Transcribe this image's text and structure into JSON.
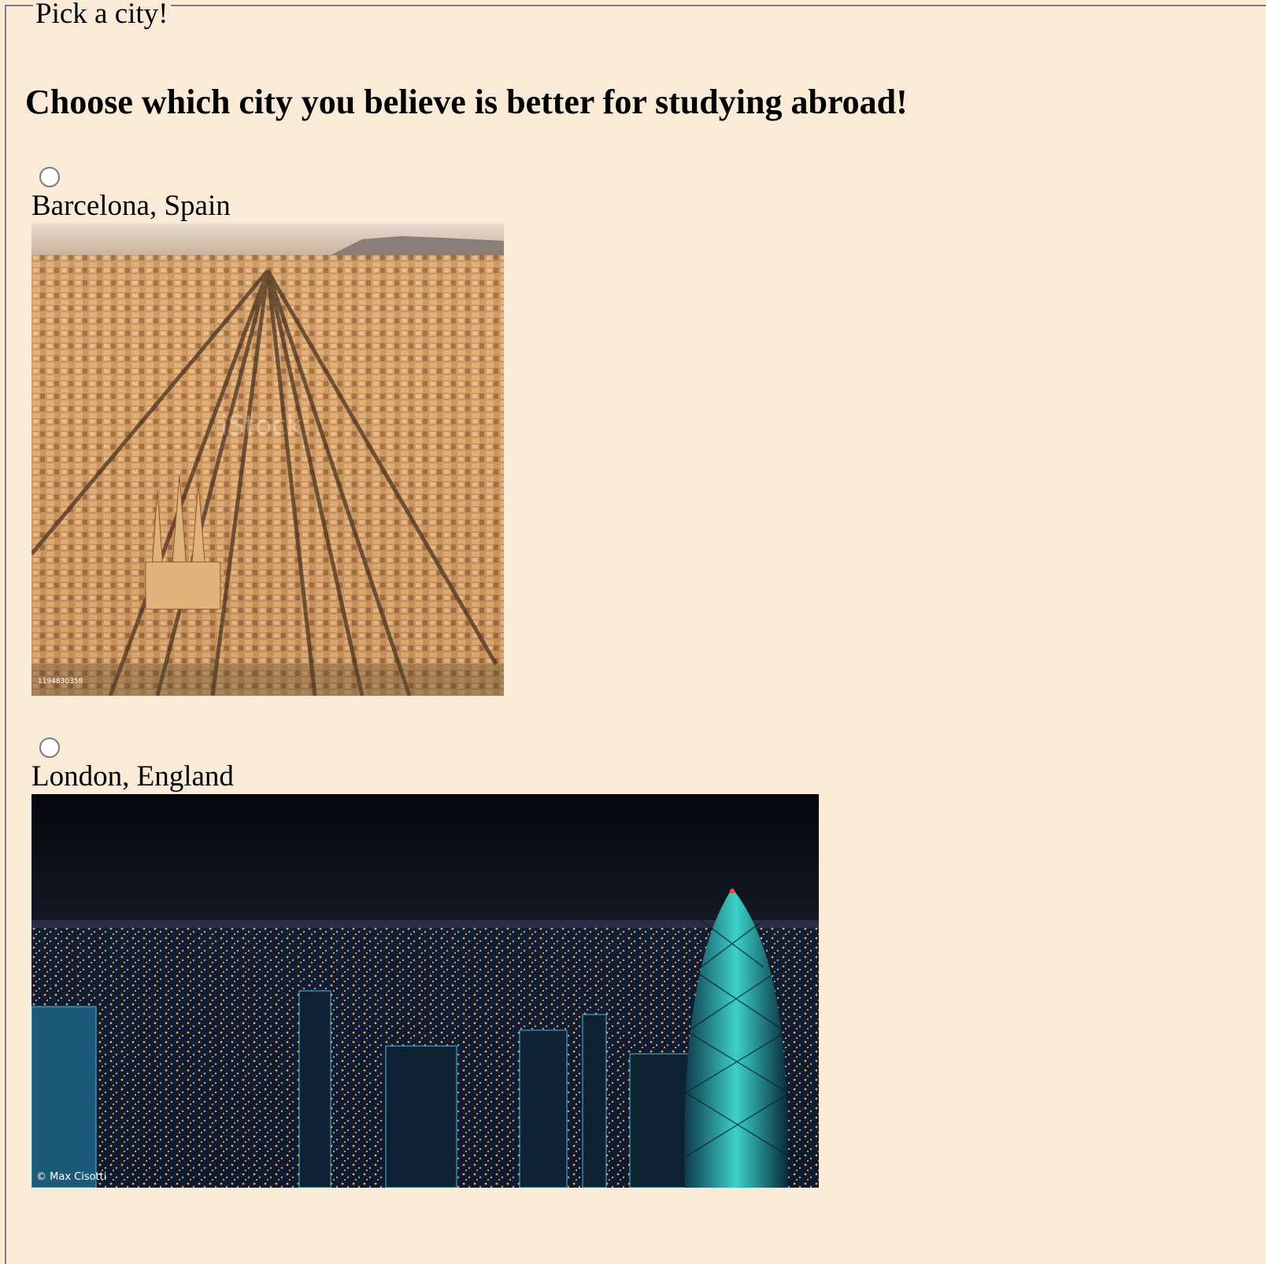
{
  "form": {
    "legend": "Pick a city!",
    "heading": "Choose which city you believe is better for studying abroad!"
  },
  "options": [
    {
      "label": "Barcelona, Spain",
      "selected": false,
      "photo_watermark": "iStock",
      "photo_id": "1194830358"
    },
    {
      "label": "London, England",
      "selected": false,
      "photo_credit": "© Max Cisotti"
    }
  ],
  "colors": {
    "page_background": "#faebd9",
    "fieldset_border": "#7a7f86"
  }
}
